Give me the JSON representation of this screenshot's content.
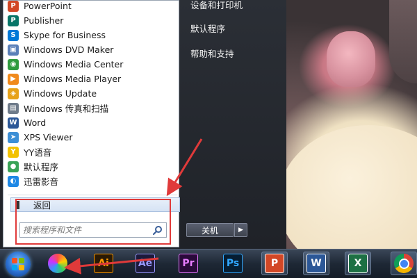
{
  "programs": [
    {
      "label": "PowerPoint",
      "icon": "powerpoint-icon",
      "color": "#d24726",
      "glyph": "P"
    },
    {
      "label": "Publisher",
      "icon": "publisher-icon",
      "color": "#077568",
      "glyph": "P"
    },
    {
      "label": "Skype for Business",
      "icon": "skype-icon",
      "color": "#0078d7",
      "glyph": "S"
    },
    {
      "label": "Windows DVD Maker",
      "icon": "dvd-maker-icon",
      "color": "#5a7fb8",
      "glyph": "▣"
    },
    {
      "label": "Windows Media Center",
      "icon": "media-center-icon",
      "color": "#2f9b3f",
      "glyph": "◉"
    },
    {
      "label": "Windows Media Player",
      "icon": "media-player-icon",
      "color": "#f08a1c",
      "glyph": "▶"
    },
    {
      "label": "Windows Update",
      "icon": "windows-update-icon",
      "color": "#e6a21a",
      "glyph": "◈"
    },
    {
      "label": "Windows 传真和扫描",
      "icon": "fax-scan-icon",
      "color": "#6f7b8a",
      "glyph": "▤"
    },
    {
      "label": "Word",
      "icon": "word-icon",
      "color": "#2b5797",
      "glyph": "W"
    },
    {
      "label": "XPS Viewer",
      "icon": "xps-viewer-icon",
      "color": "#3d8fd6",
      "glyph": "➤"
    },
    {
      "label": "YY语音",
      "icon": "yy-voice-icon",
      "color": "#f2c200",
      "glyph": "Y"
    },
    {
      "label": "默认程序",
      "icon": "default-programs-icon",
      "color": "#3aa357",
      "glyph": "●"
    },
    {
      "label": "迅雷影音",
      "icon": "xunlei-player-icon",
      "color": "#1e88e5",
      "glyph": "◐"
    }
  ],
  "back_label": "返回",
  "search": {
    "placeholder": "搜索程序和文件"
  },
  "right_links": {
    "devices": "设备和打印机",
    "default_programs": "默认程序",
    "help": "帮助和支持"
  },
  "shutdown_label": "关机",
  "taskbar": [
    {
      "name": "app-pinwheel-icon",
      "glyph": "",
      "bg": "",
      "fg": ""
    },
    {
      "name": "illustrator-icon",
      "glyph": "Ai",
      "bg": "#2a1a05",
      "fg": "#ff9a00"
    },
    {
      "name": "after-effects-icon",
      "glyph": "Ae",
      "bg": "#1c1a3a",
      "fg": "#9999ff"
    },
    {
      "name": "premiere-icon",
      "glyph": "Pr",
      "bg": "#2a0a3a",
      "fg": "#e77cff"
    },
    {
      "name": "photoshop-icon",
      "glyph": "Ps",
      "bg": "#061e33",
      "fg": "#31a8ff"
    },
    {
      "name": "powerpoint-taskbar-icon",
      "glyph": "P",
      "bg": "#d24726",
      "fg": "#ffffff"
    },
    {
      "name": "word-taskbar-icon",
      "glyph": "W",
      "bg": "#2b5797",
      "fg": "#ffffff"
    },
    {
      "name": "excel-taskbar-icon",
      "glyph": "X",
      "bg": "#1d7044",
      "fg": "#ffffff"
    },
    {
      "name": "chrome-icon",
      "glyph": "",
      "bg": "",
      "fg": ""
    }
  ]
}
